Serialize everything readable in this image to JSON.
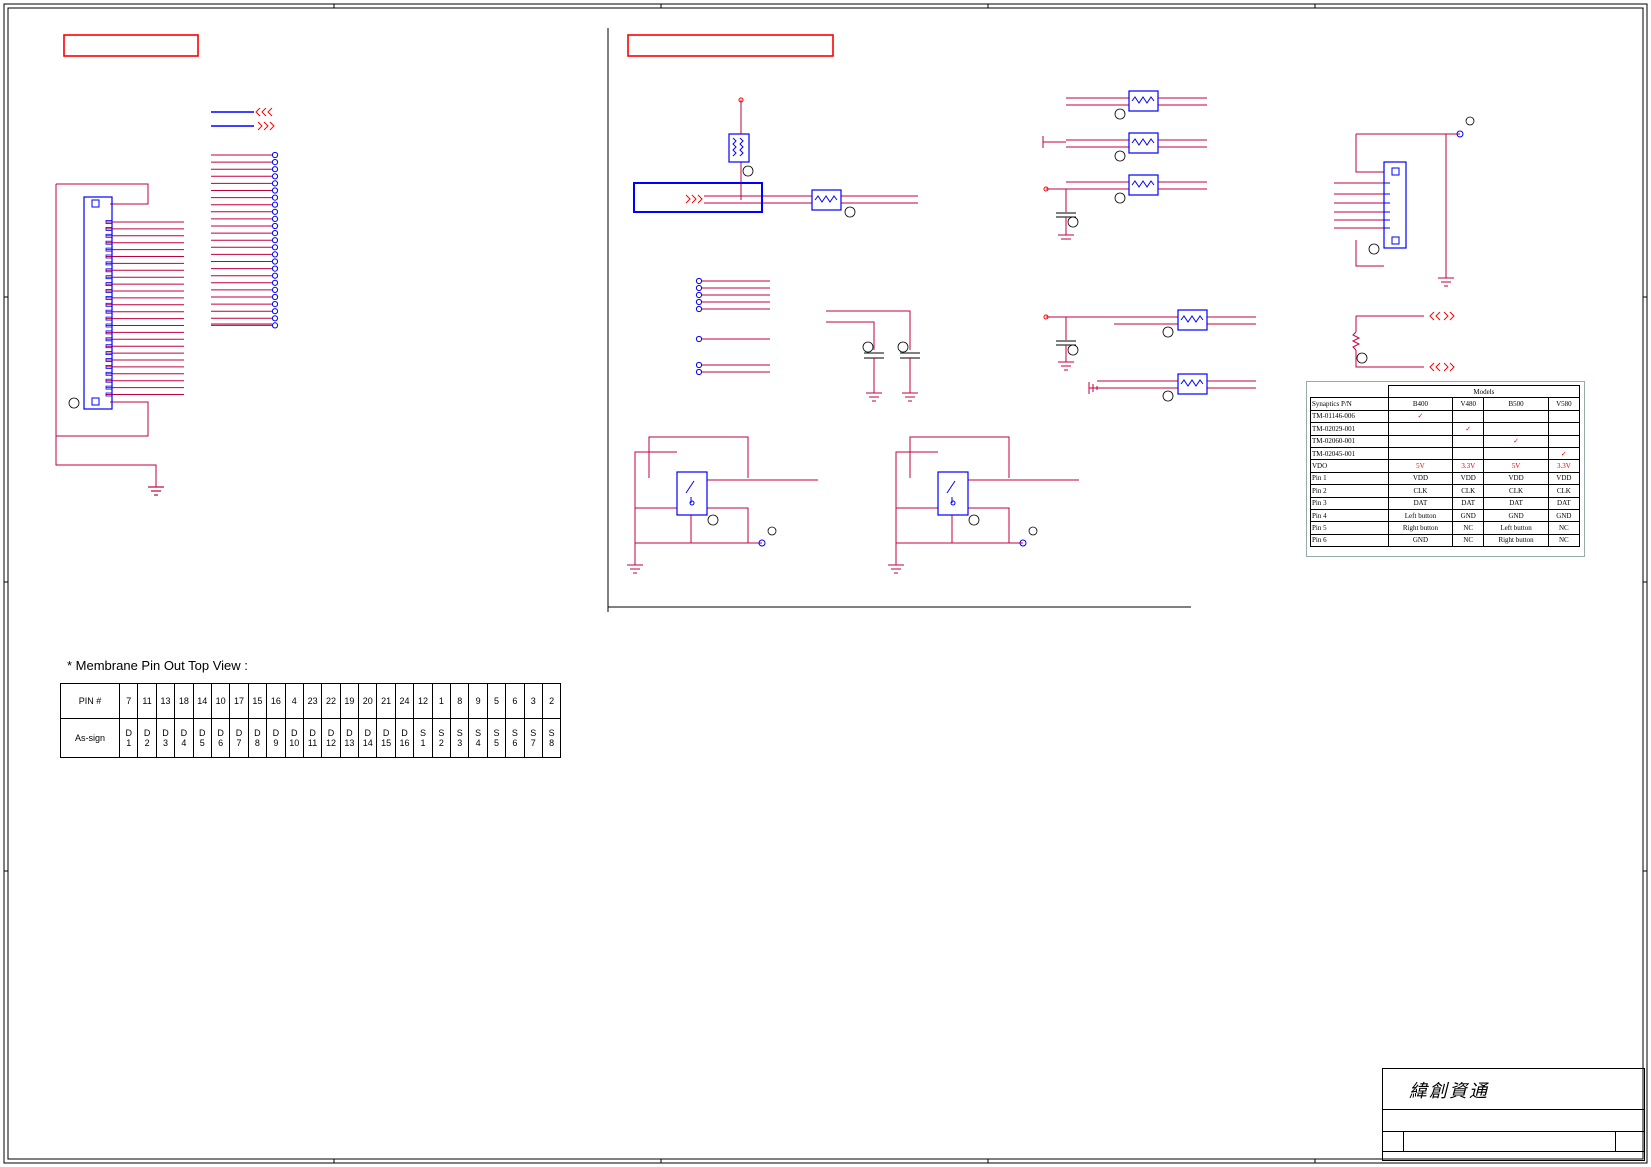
{
  "membrane": {
    "title": "* Membrane Pin Out Top View :",
    "pin_header": "PIN  #",
    "assign_header": "As-sign",
    "pins": [
      "7",
      "11",
      "13",
      "18",
      "14",
      "10",
      "17",
      "15",
      "16",
      "4",
      "23",
      "22",
      "19",
      "20",
      "21",
      "24",
      "12",
      "1",
      "8",
      "9",
      "5",
      "6",
      "3",
      "2"
    ],
    "assign": [
      [
        "D",
        "1"
      ],
      [
        "D",
        "2"
      ],
      [
        "D",
        "3"
      ],
      [
        "D",
        "4"
      ],
      [
        "D",
        "5"
      ],
      [
        "D",
        "6"
      ],
      [
        "D",
        "7"
      ],
      [
        "D",
        "8"
      ],
      [
        "D",
        "9"
      ],
      [
        "D",
        "10"
      ],
      [
        "D",
        "11"
      ],
      [
        "D",
        "12"
      ],
      [
        "D",
        "13"
      ],
      [
        "D",
        "14"
      ],
      [
        "D",
        "15"
      ],
      [
        "D",
        "16"
      ],
      [
        "S",
        "1"
      ],
      [
        "S",
        "2"
      ],
      [
        "S",
        "3"
      ],
      [
        "S",
        "4"
      ],
      [
        "S",
        "5"
      ],
      [
        "S",
        "6"
      ],
      [
        "S",
        "7"
      ],
      [
        "S",
        "8"
      ]
    ]
  },
  "models": {
    "heading": "Models",
    "col_header": "Synaptics P/N",
    "columns": [
      "B400",
      "V480",
      "B500",
      "V580"
    ],
    "part_rows": [
      {
        "pn": "TM-01146-006",
        "marks": [
          "✓",
          "",
          "",
          ""
        ]
      },
      {
        "pn": "TM-02029-001",
        "marks": [
          "",
          "✓",
          "",
          ""
        ]
      },
      {
        "pn": "TM-02060-001",
        "marks": [
          "",
          "",
          "✓",
          ""
        ]
      },
      {
        "pn": "TM-02045-001",
        "marks": [
          "",
          "",
          "",
          "✓"
        ]
      }
    ],
    "pin_rows": [
      {
        "label": "VDO",
        "values": [
          "5V",
          "3.3V",
          "5V",
          "3.3V"
        ],
        "red": true
      },
      {
        "label": "Pin 1",
        "values": [
          "VDD",
          "VDD",
          "VDD",
          "VDD"
        ],
        "red": false
      },
      {
        "label": "Pin 2",
        "values": [
          "CLK",
          "CLK",
          "CLK",
          "CLK"
        ],
        "red": false
      },
      {
        "label": "Pin 3",
        "values": [
          "DAT",
          "DAT",
          "DAT",
          "DAT"
        ],
        "red": false
      },
      {
        "label": "Pin 4",
        "values": [
          "Left button",
          "GND",
          "GND",
          "GND"
        ],
        "red": false
      },
      {
        "label": "Pin 5",
        "values": [
          "Right button",
          "NC",
          "Left button",
          "NC"
        ],
        "red": false
      },
      {
        "label": "Pin 6",
        "values": [
          "GND",
          "NC",
          "Right button",
          "NC"
        ],
        "red": false
      }
    ]
  },
  "title_block": {
    "company": "緯創資通"
  },
  "colors": {
    "wire": "#c0003c",
    "component": "#0000ff",
    "net_label": "#ff0000",
    "ink": "#000000"
  }
}
